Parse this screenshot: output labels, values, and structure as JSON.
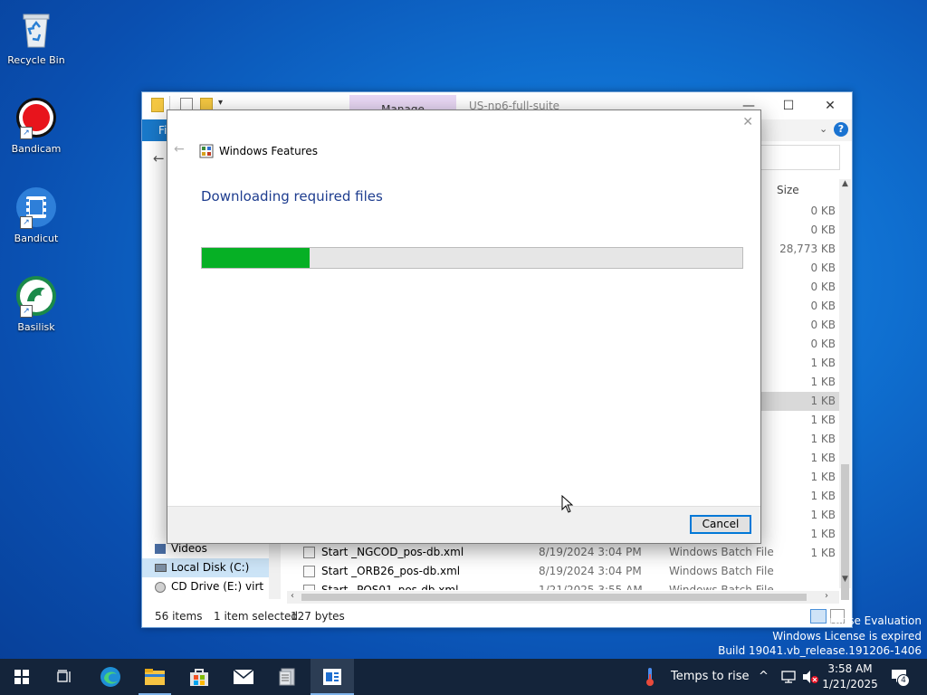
{
  "desktop": {
    "icons": [
      {
        "label": "Recycle Bin",
        "icon": "recycle-bin-icon"
      },
      {
        "label": "Bandicam",
        "icon": "bandicam-icon"
      },
      {
        "label": "Bandicut",
        "icon": "bandicut-icon"
      },
      {
        "label": "Basilisk",
        "icon": "basilisk-icon"
      }
    ],
    "watermark": {
      "line1": "rprise Evaluation",
      "line2": "Windows License is expired",
      "line3": "Build 19041.vb_release.191206-1406"
    }
  },
  "explorer": {
    "title": "US-np6-full-suite",
    "ribbon_tab": "Manage",
    "file_tab": "Fi",
    "column_size": "Size",
    "sizes": [
      "0 KB",
      "0 KB",
      "28,773 KB",
      "0 KB",
      "0 KB",
      "0 KB",
      "0 KB",
      "0 KB",
      "1 KB",
      "1 KB",
      "1 KB",
      "1 KB",
      "1 KB",
      "1 KB",
      "1 KB",
      "1 KB",
      "1 KB",
      "1 KB",
      "1 KB"
    ],
    "selected_size_index": 10,
    "nav": [
      {
        "label": "Videos"
      },
      {
        "label": "Local Disk (C:)"
      },
      {
        "label": "CD Drive (E:) virt"
      }
    ],
    "files": [
      {
        "name": "Start _NGCOD_pos-db.xml",
        "date": "8/19/2024 3:04 PM",
        "type": "Windows Batch File"
      },
      {
        "name": "Start _ORB26_pos-db.xml",
        "date": "8/19/2024 3:04 PM",
        "type": "Windows Batch File"
      },
      {
        "name": "Start _POS01_pos-db.xml",
        "date": "1/21/2025 3:55 AM",
        "type": "Windows Batch File"
      }
    ],
    "status": {
      "items": "56 items",
      "selected": "1 item selected",
      "bytes": "127 bytes"
    }
  },
  "dialog": {
    "title": "Windows Features",
    "heading": "Downloading required files",
    "progress": 0.2,
    "cancel": "Cancel",
    "close": "✕"
  },
  "taskbar": {
    "weather": "Temps to rise",
    "time": "3:58 AM",
    "date": "1/21/2025",
    "notifications": "4"
  },
  "colors": {
    "accent": "#0078d7",
    "progress_fill": "#06b025",
    "dialog_heading": "#1e3d8f"
  }
}
